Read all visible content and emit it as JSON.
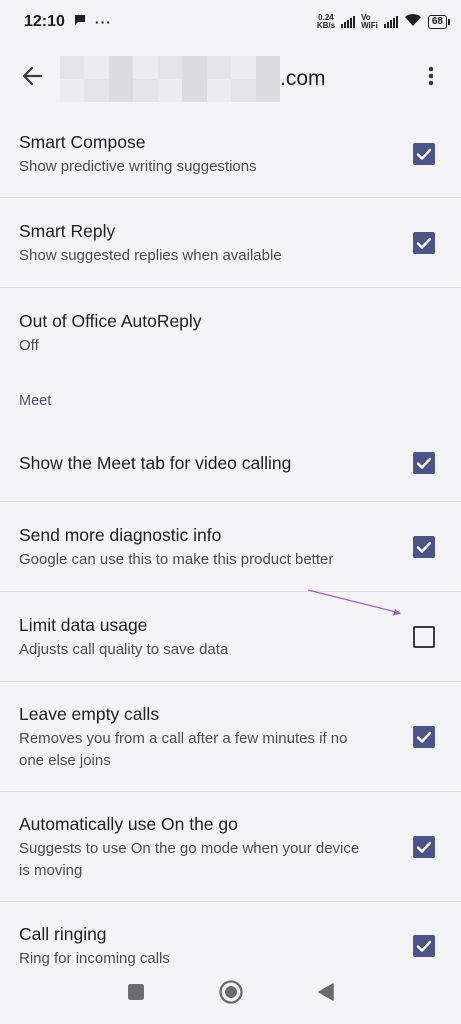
{
  "status_bar": {
    "time": "12:10",
    "dots": "···",
    "net_speed_value": "0.24",
    "net_speed_unit": "KB/s",
    "volte_top": "Vo",
    "volte_bottom": "WiFi",
    "battery": "68"
  },
  "app_bar": {
    "domain_suffix": ".com"
  },
  "settings": {
    "smart_compose": {
      "title": "Smart Compose",
      "subtitle": "Show predictive writing suggestions",
      "checked": true
    },
    "smart_reply": {
      "title": "Smart Reply",
      "subtitle": "Show suggested replies when available",
      "checked": true
    },
    "out_of_office": {
      "title": "Out of Office AutoReply",
      "subtitle": "Off"
    },
    "meet_section": "Meet",
    "meet_tab": {
      "title": "Show the Meet tab for video calling",
      "checked": true
    },
    "diagnostic": {
      "title": "Send more diagnostic info",
      "subtitle": "Google can use this to make this product better",
      "checked": true
    },
    "limit_data": {
      "title": "Limit data usage",
      "subtitle": "Adjusts call quality to save data",
      "checked": false
    },
    "leave_empty": {
      "title": "Leave empty calls",
      "subtitle": "Removes you from a call after a few minutes if no one else joins",
      "checked": true
    },
    "on_the_go": {
      "title": "Automatically use On the go",
      "subtitle": "Suggests to use On the go mode when your device is moving",
      "checked": true
    },
    "call_ringing": {
      "title": "Call ringing",
      "subtitle": "Ring for incoming calls",
      "checked": true
    }
  },
  "colors": {
    "accent": "#4a5486",
    "annotation_arrow": "#a35bd6",
    "background": "#f4f4f7"
  },
  "icons": {
    "back": "arrow-left-icon",
    "overflow": "more-vert-icon",
    "nav_recents": "square-icon",
    "nav_home": "circle-icon",
    "nav_back": "triangle-icon"
  }
}
